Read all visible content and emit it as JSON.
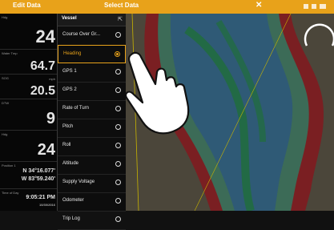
{
  "topbar": {
    "left_title": "Edit Data",
    "center_title": "Select Data",
    "close_glyph": "✕"
  },
  "data_panel": [
    {
      "label": "Hdg",
      "value": "24",
      "unit": "°M"
    },
    {
      "label": "Water Tmp",
      "value": "64.7",
      "unit": "°F"
    },
    {
      "label": "SOG",
      "value": "20.5",
      "unit": "mph"
    },
    {
      "label": "DTW",
      "value": "9",
      "unit": ""
    },
    {
      "label": "Hdg",
      "value": "24",
      "unit": ""
    },
    {
      "label": "Position 1",
      "value": "N 34°16.077'",
      "value2": "W 83°59.240'"
    },
    {
      "label": "Time of Day",
      "value": "9:05:21 PM",
      "value2": "10/30/2016"
    }
  ],
  "menu": {
    "title": "Vessel",
    "header_icon": "back-icon",
    "items": [
      {
        "label": "Course Over Gr...",
        "selected": false
      },
      {
        "label": "Heading",
        "selected": true
      },
      {
        "label": "GPS 1",
        "selected": false
      },
      {
        "label": "GPS 2",
        "selected": false
      },
      {
        "label": "Rate of Turn",
        "selected": false
      },
      {
        "label": "Pitch",
        "selected": false
      },
      {
        "label": "Roll",
        "selected": false
      },
      {
        "label": "Altitude",
        "selected": false
      },
      {
        "label": "Supply Voltage",
        "selected": false
      },
      {
        "label": "Odometer",
        "selected": false
      },
      {
        "label": "Trip Log",
        "selected": false
      }
    ]
  },
  "colors": {
    "accent": "#e8a21a"
  }
}
